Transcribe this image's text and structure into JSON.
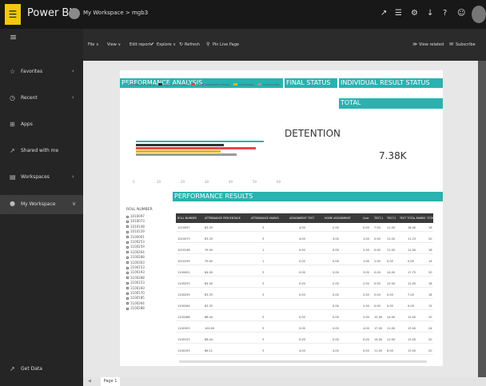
{
  "app": {
    "name": "Power BI",
    "logo_glyph": "☰",
    "breadcrumb": "My Workspace > mgb3"
  },
  "topbar": {
    "icons": [
      "expand-icon",
      "notifications-icon",
      "settings-icon",
      "download-icon",
      "help-icon",
      "feedback-icon"
    ],
    "glyphs": [
      "↗",
      "☰",
      "⚙",
      "↓",
      "?",
      "☺"
    ]
  },
  "nav": {
    "items": [
      {
        "label": "Favorites",
        "icon": "☆",
        "chevron": "›"
      },
      {
        "label": "Recent",
        "icon": "◷",
        "chevron": "›"
      },
      {
        "label": "Apps",
        "icon": "⊞",
        "chevron": ""
      },
      {
        "label": "Shared with me",
        "icon": "↗",
        "chevron": ""
      },
      {
        "label": "Workspaces",
        "icon": "▤",
        "chevron": "›"
      },
      {
        "label": "My Workspace",
        "icon": "●",
        "chevron": "∨"
      }
    ],
    "get_data": "Get Data",
    "hamburger": "≡"
  },
  "cmdbar": {
    "file": "File ∨",
    "view": "View ∨",
    "edit": "Edit report",
    "explore": "Explore ∨",
    "refresh": "Refresh",
    "pin": "Pin Live Page",
    "view_related": "View related",
    "subscribe": "Subscribe"
  },
  "report": {
    "perf_title": "PERFORMANCE ANALYSIS",
    "final_title": "FINAL STATUS",
    "indiv_title": "INDIVIDUAL RESULT STATUS",
    "detention": "DETENTION",
    "total_label": "TOTAL",
    "total_value": "7.38K",
    "results_title": "PERFORMANCE RESULTS",
    "legend": [
      {
        "label": "ATTENDANCE MARKS",
        "color": "#29b2b0"
      },
      {
        "label": "SUM of TEST MARKS",
        "color": "#333333"
      },
      {
        "label": "HOME ASSIGNMENT MARKS",
        "color": "#e8474c"
      },
      {
        "label": "QUIZ MARKS",
        "color": "#e6b325"
      },
      {
        "label": "TOTAL MARKS",
        "color": "#9a9a9a"
      }
    ],
    "axis_ticks": [
      "0",
      "10",
      "20",
      "30",
      "40",
      "50",
      "60"
    ],
    "slicer_header": "ROLL NUMBER",
    "slicer_items": [
      "1010097",
      "1010073",
      "1010148",
      "1010159",
      "1100001",
      "1100253",
      "1100259",
      "1100264",
      "1100288",
      "1100303",
      "1100153",
      "1100193",
      "1100288",
      "1100153",
      "1100160",
      "1100170",
      "1100185",
      "1100264",
      "1100288"
    ],
    "columns": [
      "ROLL NUMBER",
      "ATTENDANCE PERCENTAGE",
      "ATTENDANCE MARKS",
      "ASSIGNMENT TEST",
      "HOME ASSIGNMENT",
      "Quiz",
      "TEST-1",
      "TEST-2",
      "TEST TOTAL MARKS",
      "TOTAL"
    ],
    "rows": [
      [
        "1010097",
        "83.33",
        "3",
        "4.00",
        "2.00",
        "0.00",
        "7.00",
        "11.00",
        "18.00",
        "16"
      ],
      [
        "1010073",
        "83.33",
        "3",
        "4.00",
        "4.00",
        "1.00",
        "0.00",
        "11.00",
        "11.23",
        "20"
      ],
      [
        "1010148",
        "79.00",
        "1",
        "0.00",
        "0.00",
        "2.00",
        "0.00",
        "11.00",
        "11.00",
        "18"
      ],
      [
        "1010159",
        "79.00",
        "1",
        "0.00",
        "0.00",
        "1.00",
        "2.00",
        "0.00",
        "0.00",
        "14"
      ],
      [
        "1100001",
        "84.00",
        "3",
        "0.00",
        "0.00",
        "3.00",
        "0.00",
        "14.00",
        "17.75",
        "20"
      ],
      [
        "1100253",
        "84.00",
        "3",
        "0.00",
        "2.00",
        "2.00",
        "0.00",
        "12.00",
        "11.00",
        "18"
      ],
      [
        "1100259",
        "83.33",
        "3",
        "0.00",
        "0.00",
        "2.00",
        "0.00",
        "0.00",
        "7.00",
        "18"
      ],
      [
        "1100264",
        "83.33",
        "",
        "",
        "0.00",
        "2.00",
        "0.00",
        "0.00",
        "0.00",
        "15"
      ],
      [
        "1100288",
        "88.44",
        "3",
        "0.00",
        "0.00",
        "2.00",
        "12.00",
        "14.00",
        "13.00",
        "20"
      ],
      [
        "1100303",
        "100.00",
        "3",
        "0.00",
        "0.00",
        "4.00",
        "17.00",
        "11.00",
        "13.00",
        "24"
      ],
      [
        "1100153",
        "88.44",
        "3",
        "0.00",
        "0.00",
        "0.00",
        "14.00",
        "11.00",
        "13.00",
        "20"
      ],
      [
        "1100193",
        "86.11",
        "3",
        "4.00",
        "4.00",
        "0.00",
        "11.00",
        "6.00",
        "13.00",
        "20"
      ]
    ]
  },
  "footer": {
    "page_tab": "Page 1"
  }
}
